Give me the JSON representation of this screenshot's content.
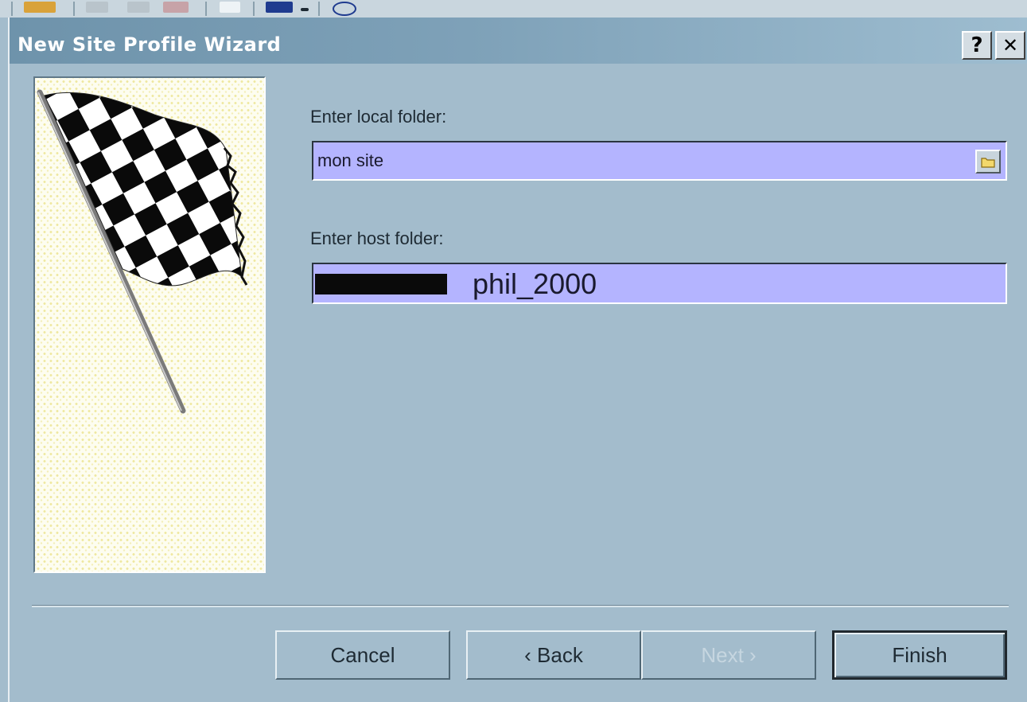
{
  "dialog": {
    "title": "New Site Profile Wizard",
    "help_label": "?",
    "close_label": "✕"
  },
  "form": {
    "local_folder_label": "Enter local folder:",
    "local_folder_value": "mon site",
    "host_folder_label": "Enter host folder:",
    "host_folder_value": "phil_2000"
  },
  "buttons": {
    "cancel": "Cancel",
    "back": "‹ Back",
    "next": "Next ›",
    "finish": "Finish"
  },
  "icons": {
    "flag": "checkered-flag-icon",
    "browse": "folder-icon"
  },
  "colors": {
    "field_bg": "#b4b4ff",
    "dialog_bg": "#a3bccc",
    "titlebar": "#7ea1b8"
  }
}
